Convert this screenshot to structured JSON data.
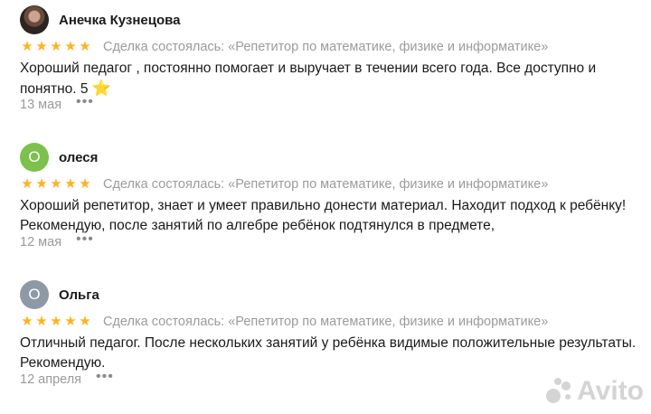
{
  "reviews": [
    {
      "author": "Анечка Кузнецова",
      "avatar_letter": "",
      "avatar_type": "photo",
      "stars": [
        "★",
        "★",
        "★",
        "★",
        "★"
      ],
      "deal": "Сделка состоялась: «Репетитор по математике, физике и информатике»",
      "text": "Хороший педагог , постоянно помогает и выручает в течении всего года. Все доступно и понятно. 5",
      "emoji": "⭐",
      "date": "13 мая",
      "more": "•••"
    },
    {
      "author": "олеся",
      "avatar_letter": "О",
      "avatar_type": "green",
      "stars": [
        "★",
        "★",
        "★",
        "★",
        "★"
      ],
      "deal": "Сделка состоялась: «Репетитор по математике, физике и информатике»",
      "text": "Хороший репетитор, знает и умеет правильно донести материал. Находит подход к ребёнку! Рекомендую, после занятий по алгебре ребёнок подтянулся в предмете,",
      "date": "12 мая",
      "more": "•••"
    },
    {
      "author": "Ольга",
      "avatar_letter": "О",
      "avatar_type": "grey",
      "stars": [
        "★",
        "★",
        "★",
        "★",
        "★"
      ],
      "deal": "Сделка состоялась: «Репетитор по математике, физике и информатике»",
      "text": "Отличный педагог. После нескольких занятий у ребёнка видимые положительные результаты. Рекомендую.",
      "date": "12 апреля",
      "more": "•••"
    }
  ],
  "rating_value": 5,
  "rating_max": 5,
  "watermark": "Avito",
  "colors": {
    "star": "#ffb21e",
    "muted": "#9b9b9b",
    "avatar_green": "#7cc14b",
    "avatar_grey": "#8d9aa6"
  }
}
